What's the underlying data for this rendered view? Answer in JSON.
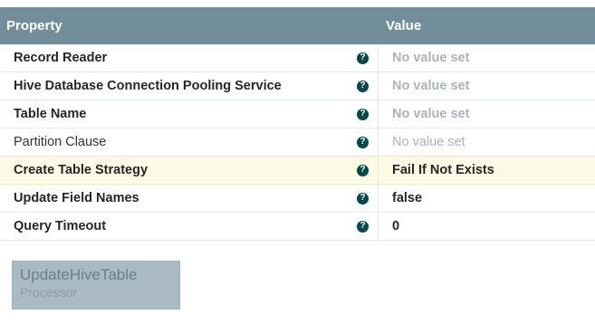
{
  "table": {
    "header": {
      "property": "Property",
      "value": "Value"
    },
    "rows": [
      {
        "name": "Record Reader",
        "value": "No value set"
      },
      {
        "name": "Hive Database Connection Pooling Service",
        "value": "No value set"
      },
      {
        "name": "Table Name",
        "value": "No value set"
      },
      {
        "name": "Partition Clause",
        "value": "No value set"
      },
      {
        "name": "Create Table Strategy",
        "value": "Fail If Not Exists"
      },
      {
        "name": "Update Field Names",
        "value": "false"
      },
      {
        "name": "Query Timeout",
        "value": "0"
      }
    ],
    "help_glyph": "?"
  },
  "processor": {
    "name": "UpdateHiveTable",
    "type": "Processor"
  },
  "colors": {
    "header_bg": "#728e9b",
    "highlight_row_bg": "#fcf9e5",
    "help_icon": "#004849",
    "unset_value": "#aeb3b6",
    "processor_card_bg": "#aabbc3"
  }
}
